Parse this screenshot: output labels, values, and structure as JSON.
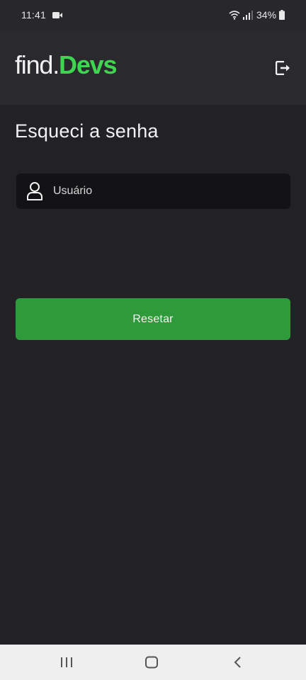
{
  "status_bar": {
    "time": "11:41",
    "battery": "34%",
    "icons": [
      "video-icon",
      "wifi-icon",
      "signal-icon",
      "battery-icon"
    ]
  },
  "header": {
    "logo_part1": "find.",
    "logo_part2": "Devs",
    "logo_accent_color": "#3fd64f",
    "logout_icon": "logout-icon"
  },
  "main": {
    "title": "Esqueci a senha",
    "username_field": {
      "placeholder": "Usuário",
      "value": "",
      "icon": "user-icon"
    },
    "reset_button": {
      "label": "Resetar",
      "color": "#2e9a3a"
    }
  },
  "nav_bar": {
    "buttons": [
      "recents-icon",
      "home-icon",
      "back-icon"
    ]
  }
}
